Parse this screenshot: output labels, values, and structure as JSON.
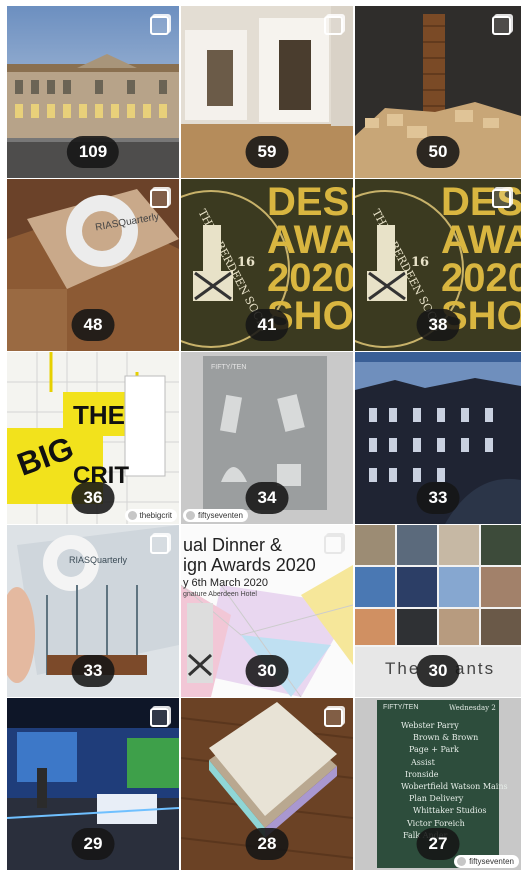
{
  "posts": [
    {
      "count": "109",
      "multi": true
    },
    {
      "count": "59",
      "multi": true
    },
    {
      "count": "50",
      "multi": true
    },
    {
      "count": "48",
      "multi": true,
      "text": [
        "RIASQuarterly"
      ]
    },
    {
      "count": "41",
      "multi": false,
      "text": [
        "DESIG",
        "AWARD",
        "2020",
        "SHORTL",
        "THE ABERDEEN SOCIE",
        "16"
      ]
    },
    {
      "count": "38",
      "multi": true,
      "text": [
        "DESIG",
        "AWARD",
        "2020",
        "SHORTL",
        "THE ABERDEEN SOCIE",
        "16"
      ]
    },
    {
      "count": "36",
      "multi": false,
      "text": [
        "THE",
        "BIG",
        "CRIT"
      ],
      "credit": "thebigcrit"
    },
    {
      "count": "34",
      "multi": false,
      "text": [
        "FIFTY/TEN"
      ],
      "credit": "fiftyseventen"
    },
    {
      "count": "33",
      "multi": false
    },
    {
      "count": "33",
      "multi": true,
      "text": [
        "RIASQuarterly"
      ]
    },
    {
      "count": "30",
      "multi": true,
      "text": [
        "ual Dinner &",
        "ign Awards 2020",
        "y 6th March 2020",
        "gnature Aberdeen Hotel"
      ]
    },
    {
      "count": "30",
      "multi": false,
      "text": [
        "The",
        "ants"
      ]
    },
    {
      "count": "29",
      "multi": true
    },
    {
      "count": "28",
      "multi": true
    },
    {
      "count": "27",
      "multi": false,
      "text": [
        "FIFTY/TEN",
        "Wednesday 2",
        "Webster Parry",
        "Brown & Brown",
        "Page + Park",
        "Assist",
        "Ironside",
        "Wobertfield Watson Mains",
        "Plan Delivery",
        "Whittaker Studios",
        "Victor Foreich",
        "Falk Ander"
      ],
      "credit": "fiftyseventen"
    }
  ]
}
